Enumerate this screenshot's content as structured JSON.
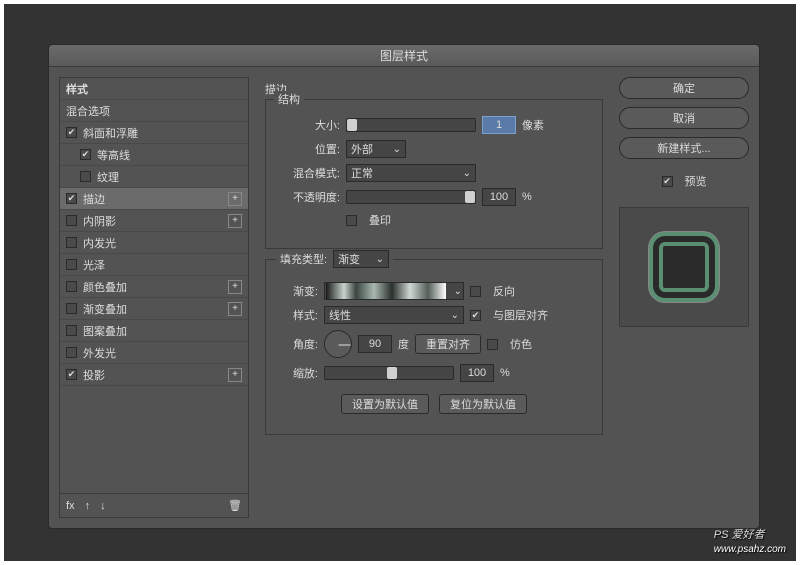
{
  "dialog": {
    "title": "图层样式"
  },
  "left": {
    "header": "样式",
    "blendOptions": "混合选项",
    "items": [
      {
        "label": "斜面和浮雕",
        "checked": true,
        "plus": false,
        "indent": 0
      },
      {
        "label": "等高线",
        "checked": true,
        "plus": false,
        "indent": 1
      },
      {
        "label": "纹理",
        "checked": false,
        "plus": false,
        "indent": 1
      },
      {
        "label": "描边",
        "checked": true,
        "plus": true,
        "indent": 0,
        "selected": true
      },
      {
        "label": "内阴影",
        "checked": false,
        "plus": true,
        "indent": 0
      },
      {
        "label": "内发光",
        "checked": false,
        "plus": false,
        "indent": 0
      },
      {
        "label": "光泽",
        "checked": false,
        "plus": false,
        "indent": 0
      },
      {
        "label": "颜色叠加",
        "checked": false,
        "plus": true,
        "indent": 0
      },
      {
        "label": "渐变叠加",
        "checked": false,
        "plus": true,
        "indent": 0
      },
      {
        "label": "图案叠加",
        "checked": false,
        "plus": false,
        "indent": 0
      },
      {
        "label": "外发光",
        "checked": false,
        "plus": false,
        "indent": 0
      },
      {
        "label": "投影",
        "checked": true,
        "plus": true,
        "indent": 0
      }
    ],
    "fx": "fx"
  },
  "mid": {
    "groupTitle": "描边",
    "structTitle": "结构",
    "size": {
      "label": "大小:",
      "value": "1",
      "unit": "像素"
    },
    "position": {
      "label": "位置:",
      "value": "外部"
    },
    "blendMode": {
      "label": "混合模式:",
      "value": "正常"
    },
    "opacity": {
      "label": "不透明度:",
      "value": "100",
      "unit": "%"
    },
    "overprint": {
      "label": "叠印"
    },
    "fillType": {
      "label": "填充类型:",
      "value": "渐变"
    },
    "gradient": {
      "label": "渐变:",
      "reverse": "反向"
    },
    "style": {
      "label": "样式:",
      "value": "线性",
      "align": "与图层对齐"
    },
    "angle": {
      "label": "角度:",
      "value": "90",
      "unit": "度",
      "reset": "重置对齐",
      "dither": "仿色"
    },
    "scale": {
      "label": "缩放:",
      "value": "100",
      "unit": "%"
    },
    "setDefault": "设置为默认值",
    "resetDefault": "复位为默认值"
  },
  "right": {
    "ok": "确定",
    "cancel": "取消",
    "newStyle": "新建样式...",
    "preview": "预览"
  },
  "watermark": {
    "brand": "PS 爱好者",
    "url": "www.psahz.com"
  }
}
